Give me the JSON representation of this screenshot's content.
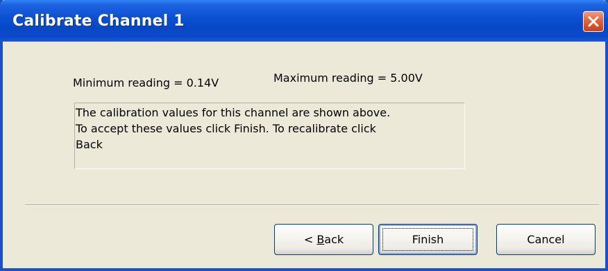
{
  "window": {
    "title": "Calibrate Channel 1",
    "close_icon": "close-icon"
  },
  "readings": {
    "minimum": "Minimum reading = 0.14V",
    "maximum": "Maximum reading = 5.00V"
  },
  "message": "The calibration values for this channel are shown above.\nTo accept these values click Finish.  To recalibrate click\nBack",
  "buttons": {
    "back_prefix": "< ",
    "back_mnemonic": "B",
    "back_rest": "ack",
    "finish": "Finish",
    "cancel": "Cancel"
  },
  "colors": {
    "titlebar": "#0a4fd0",
    "close": "#e4633c",
    "dialog_bg": "#ece9d8"
  }
}
